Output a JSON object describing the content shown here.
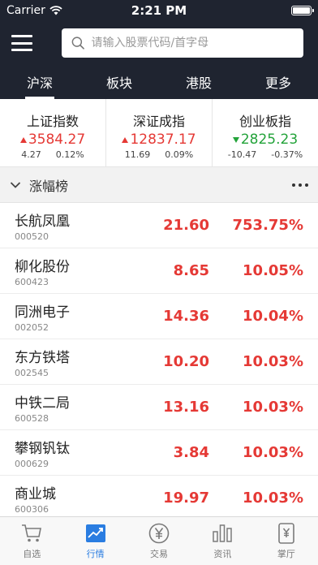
{
  "status": {
    "carrier": "Carrier",
    "time": "2:21 PM"
  },
  "search": {
    "placeholder": "请输入股票代码/首字母"
  },
  "tabs": [
    {
      "label": "沪深",
      "active": true
    },
    {
      "label": "板块",
      "active": false
    },
    {
      "label": "港股",
      "active": false
    },
    {
      "label": "更多",
      "active": false
    }
  ],
  "indices": [
    {
      "name": "上证指数",
      "value": "3584.27",
      "change": "4.27",
      "pct": "0.12%",
      "direction": "up"
    },
    {
      "name": "深证成指",
      "value": "12837.17",
      "change": "11.69",
      "pct": "0.09%",
      "direction": "up"
    },
    {
      "name": "创业板指",
      "value": "2825.23",
      "change": "-10.47",
      "pct": "-0.37%",
      "direction": "down"
    }
  ],
  "section": {
    "title": "涨幅榜"
  },
  "stocks": [
    {
      "name": "长航凤凰",
      "code": "000520",
      "price": "21.60",
      "pct": "753.75%"
    },
    {
      "name": "柳化股份",
      "code": "600423",
      "price": "8.65",
      "pct": "10.05%"
    },
    {
      "name": "同洲电子",
      "code": "002052",
      "price": "14.36",
      "pct": "10.04%"
    },
    {
      "name": "东方铁塔",
      "code": "002545",
      "price": "10.20",
      "pct": "10.03%"
    },
    {
      "name": "中铁二局",
      "code": "600528",
      "price": "13.16",
      "pct": "10.03%"
    },
    {
      "name": "攀钢钒钛",
      "code": "000629",
      "price": "3.84",
      "pct": "10.03%"
    },
    {
      "name": "商业城",
      "code": "600306",
      "price": "19.97",
      "pct": "10.03%"
    }
  ],
  "tabbar": [
    {
      "label": "自选",
      "icon": "cart-icon",
      "active": false
    },
    {
      "label": "行情",
      "icon": "trend-icon",
      "active": true
    },
    {
      "label": "交易",
      "icon": "yen-icon",
      "active": false
    },
    {
      "label": "资讯",
      "icon": "bars-icon",
      "active": false
    },
    {
      "label": "掌厅",
      "icon": "phone-yen-icon",
      "active": false
    }
  ],
  "colors": {
    "header_bg": "#1f2430",
    "up": "#e53935",
    "down": "#23a33a",
    "active_tab": "#2a7de1"
  }
}
